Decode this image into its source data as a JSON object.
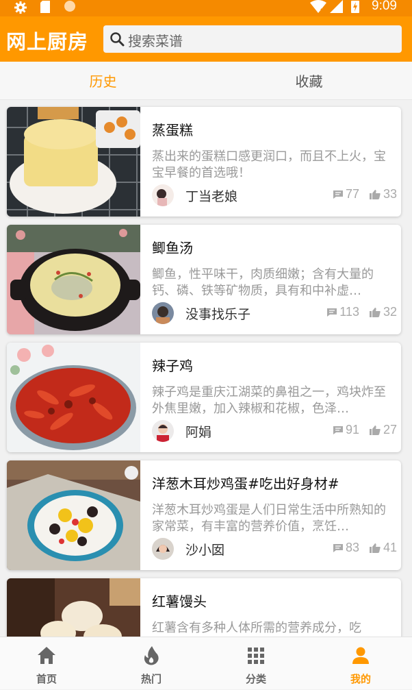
{
  "status_bar": {
    "time": "9:09",
    "icons": [
      "gear-icon",
      "sd-card-icon",
      "circle-icon",
      "wifi-off-icon",
      "signal-icon",
      "battery-charging-icon"
    ]
  },
  "app_bar": {
    "title": "网上厨房",
    "search_placeholder": "搜索菜谱"
  },
  "tabs": [
    {
      "label": "历史",
      "active": true
    },
    {
      "label": "收藏",
      "active": false
    }
  ],
  "recipes": [
    {
      "name": "蒸蛋糕",
      "desc": "蒸出来的蛋糕口感更润口，而且不上火，宝宝早餐的首选哦！",
      "author": "丁当老娘",
      "comments": "77",
      "likes": "33"
    },
    {
      "name": "鲫鱼汤",
      "desc": "鲫鱼，性平味干，肉质细嫩；含有大量的钙、磷、铁等矿物质，具有和中补虚…",
      "author": "没事找乐子",
      "comments": "113",
      "likes": "32"
    },
    {
      "name": "辣子鸡",
      "desc": "辣子鸡是重庆江湖菜的鼻祖之一，鸡块炸至外焦里嫩，加入辣椒和花椒，色泽…",
      "author": "阿娟",
      "comments": "91",
      "likes": "27"
    },
    {
      "name": "洋葱木耳炒鸡蛋#吃出好身材#",
      "desc": "洋葱木耳炒鸡蛋是人们日常生活中所熟知的家常菜，有丰富的营养价值，烹饪…",
      "author": "沙小囡",
      "comments": "83",
      "likes": "41"
    },
    {
      "name": "红薯馒头",
      "desc": "红薯含有多种人体所需的营养成分，吃",
      "author": "",
      "comments": "",
      "likes": ""
    }
  ],
  "bottom_nav": [
    {
      "label": "首页",
      "icon": "home-icon",
      "active": false
    },
    {
      "label": "热门",
      "icon": "flame-icon",
      "active": false
    },
    {
      "label": "分类",
      "icon": "grid-icon",
      "active": false
    },
    {
      "label": "我的",
      "icon": "person-icon",
      "active": true
    }
  ],
  "colors": {
    "accent": "#ff9800",
    "status_bar": "#f58a00"
  }
}
